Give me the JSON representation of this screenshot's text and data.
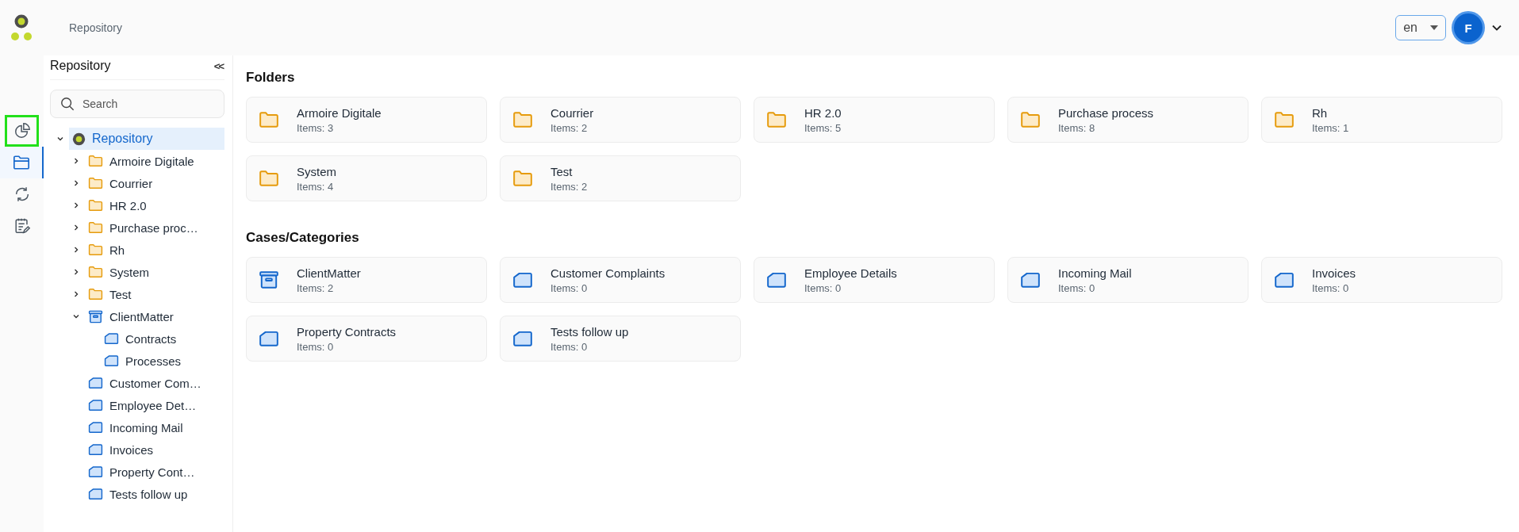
{
  "header": {
    "breadcrumb": "Repository",
    "language": "en",
    "avatar_initial": "F"
  },
  "rail": [
    {
      "selected": false,
      "highlighted": true
    },
    {
      "selected": true,
      "highlighted": false
    },
    {
      "selected": false,
      "highlighted": false
    },
    {
      "selected": false,
      "highlighted": false
    }
  ],
  "tree_panel": {
    "title": "Repository",
    "collapse": "<<",
    "search": {
      "placeholder": "Search"
    },
    "tree": [
      {
        "label": "Repository",
        "kind": "root",
        "expanded": true,
        "selected": true,
        "children": [
          {
            "label": "Armoire Digitale",
            "kind": "folder",
            "expanded": false,
            "selected": false
          },
          {
            "label": "Courrier",
            "kind": "folder",
            "expanded": false,
            "selected": false
          },
          {
            "label": "HR 2.0",
            "kind": "folder",
            "expanded": false,
            "selected": false
          },
          {
            "label": "Purchase proc…",
            "kind": "folder",
            "expanded": false,
            "selected": false
          },
          {
            "label": "Rh",
            "kind": "folder",
            "expanded": false,
            "selected": false
          },
          {
            "label": "System",
            "kind": "folder",
            "expanded": false,
            "selected": false
          },
          {
            "label": "Test",
            "kind": "folder",
            "expanded": false,
            "selected": false
          },
          {
            "label": "ClientMatter",
            "kind": "case",
            "expanded": true,
            "selected": false,
            "children": [
              {
                "label": "Contracts",
                "kind": "category",
                "selected": false
              },
              {
                "label": "Processes",
                "kind": "category",
                "selected": false
              }
            ]
          },
          {
            "label": "Customer Com…",
            "kind": "category",
            "selected": false
          },
          {
            "label": "Employee Det…",
            "kind": "category",
            "selected": false
          },
          {
            "label": "Incoming Mail",
            "kind": "category",
            "selected": false
          },
          {
            "label": "Invoices",
            "kind": "category",
            "selected": false
          },
          {
            "label": "Property Cont…",
            "kind": "category",
            "selected": false
          },
          {
            "label": "Tests follow up",
            "kind": "category",
            "selected": false
          }
        ]
      }
    ]
  },
  "sections": [
    {
      "title": "Folders",
      "cards": [
        {
          "name": "Armoire Digitale",
          "count": "Items: 3",
          "kind": "folder"
        },
        {
          "name": "Courrier",
          "count": "Items: 2",
          "kind": "folder"
        },
        {
          "name": "HR 2.0",
          "count": "Items: 5",
          "kind": "folder"
        },
        {
          "name": "Purchase process",
          "count": "Items: 8",
          "kind": "folder"
        },
        {
          "name": "Rh",
          "count": "Items: 1",
          "kind": "folder"
        },
        {
          "name": "System",
          "count": "Items: 4",
          "kind": "folder"
        },
        {
          "name": "Test",
          "count": "Items: 2",
          "kind": "folder"
        }
      ]
    },
    {
      "title": "Cases/Categories",
      "cards": [
        {
          "name": "ClientMatter",
          "count": "Items: 2",
          "kind": "case"
        },
        {
          "name": "Customer Complaints",
          "count": "Items: 0",
          "kind": "category"
        },
        {
          "name": "Employee Details",
          "count": "Items: 0",
          "kind": "category"
        },
        {
          "name": "Incoming Mail",
          "count": "Items: 0",
          "kind": "category"
        },
        {
          "name": "Invoices",
          "count": "Items: 0",
          "kind": "category"
        },
        {
          "name": "Property Contracts",
          "count": "Items: 0",
          "kind": "category"
        },
        {
          "name": "Tests follow up",
          "count": "Items: 0",
          "kind": "category"
        }
      ]
    }
  ]
}
